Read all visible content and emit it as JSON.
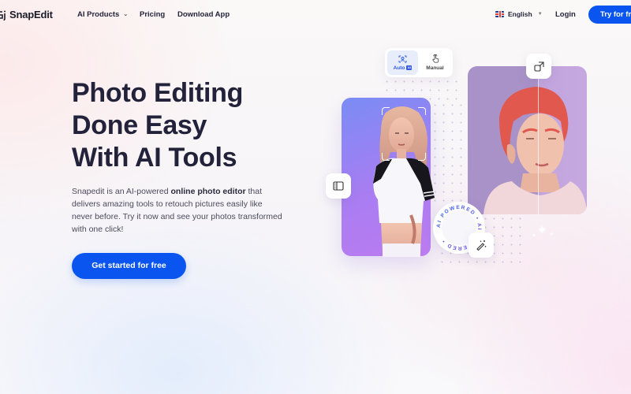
{
  "nav": {
    "logo_text": "SnapEdit",
    "links": [
      {
        "label": "AI Products",
        "has_dropdown": true
      },
      {
        "label": "Pricing"
      },
      {
        "label": "Download App"
      }
    ],
    "language": {
      "label": "English",
      "flag": "uk-flag-icon"
    },
    "login_label": "Login",
    "try_label": "Try for free"
  },
  "hero": {
    "title_lines": [
      "Photo Editing",
      "Done Easy",
      "With AI Tools"
    ],
    "description": {
      "before": "Snapedit is an AI-powered ",
      "bold": "online photo editor",
      "after": " that delivers amazing tools to retouch pictures easily like never before. Try it now and see your photos transformed with one click!"
    },
    "cta_label": "Get started for free"
  },
  "visual": {
    "mode_toggle": [
      {
        "label": "Auto",
        "badge": "AI",
        "icon": "face-scan-icon",
        "active": true
      },
      {
        "label": "Manual",
        "icon": "hand-pointer-icon",
        "active": false
      }
    ],
    "ai_badge_text": "AI POWERED • AI POWERED •",
    "colors": {
      "brand": "#0a55f0",
      "card_left_gradient": [
        "#7a8cf5",
        "#bb7cf0"
      ],
      "card_right_bg": "#a892c8"
    }
  }
}
